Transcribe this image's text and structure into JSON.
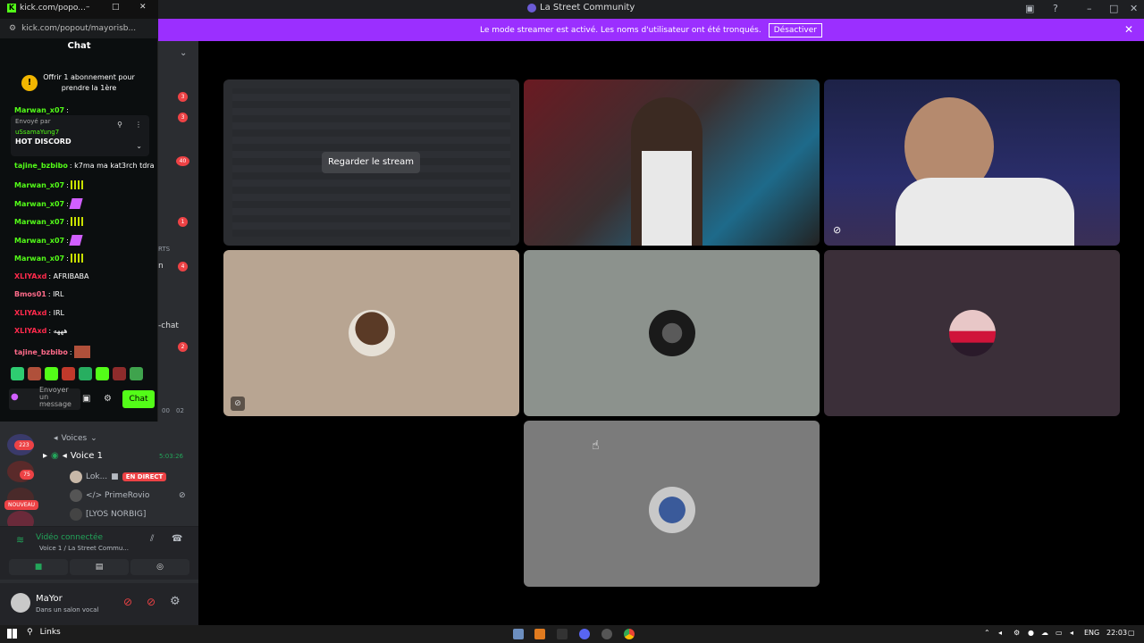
{
  "discord": {
    "window_title": "La Street Community",
    "banner_text": "Le mode streamer est activé. Les noms d'utilisateur ont été tronqués.",
    "banner_button": "Désactiver",
    "side_badges": [
      "3",
      "3",
      "40",
      "1",
      "4",
      "2"
    ],
    "side_fragments": [
      "RTS",
      "n",
      "-chat",
      "00",
      "02"
    ],
    "server_badges": [
      "223",
      "75",
      "NOUVEAU"
    ],
    "voices_category": "Voices",
    "voice_channel": "Voice 1",
    "voice_timer": "5:03:26",
    "voice_members": [
      {
        "name": "Lok...",
        "live": "EN DIRECT"
      },
      {
        "name": "</> PrimeRovio"
      },
      {
        "name": "[LYOS NORBIG]"
      }
    ],
    "voice_status": "Vidéo connectée",
    "voice_sub": "Voice 1 / La Street Commu...",
    "user_name": "MaYor",
    "user_status": "Dans un salon vocal",
    "watch_stream_button": "Regarder le stream",
    "tile_colors": [
      "#2b2d31",
      "#3a3031",
      "#1d2247",
      "#b8a592",
      "#8c928d",
      "#3b2f39",
      "#7b7b7b"
    ]
  },
  "kick": {
    "tab_title": "kick.com/popo...",
    "url": "kick.com/popout/mayorisb...",
    "chat_header": "Chat",
    "gift_text": "Offrir 1 abonnement pour prendre la 1ère",
    "pinned_by": "Envoyé par",
    "pinned_user": "uSsamaYung7",
    "pinned_text": "HOT DISCORD",
    "messages": [
      {
        "user": "Marwan_x07",
        "text": ":"
      },
      {
        "user": "tajine_bzbibo",
        "text": ": k7ma ma kat3rch tdra"
      },
      {
        "user": "Marwan_x07",
        "text": ":"
      },
      {
        "user": "Marwan_x07",
        "text": ":"
      },
      {
        "user": "Marwan_x07",
        "text": ":"
      },
      {
        "user": "Marwan_x07",
        "text": ":"
      },
      {
        "user": "Marwan_x07",
        "text": ":"
      },
      {
        "user": "XLIYAxd",
        "text": ": AFRIBABA"
      },
      {
        "user": "Bmos01",
        "text": ": IRL"
      },
      {
        "user": "XLIYAxd",
        "text": ": IRL"
      },
      {
        "user": "XLIYAxd",
        "text": ": هههه"
      },
      {
        "user": "tajine_bzbibo",
        "text": ":"
      }
    ],
    "input_placeholder": "Envoyer un message",
    "chat_button": "Chat"
  },
  "taskbar": {
    "search_label": "Links",
    "lang": "ENG",
    "time": "22:03"
  }
}
